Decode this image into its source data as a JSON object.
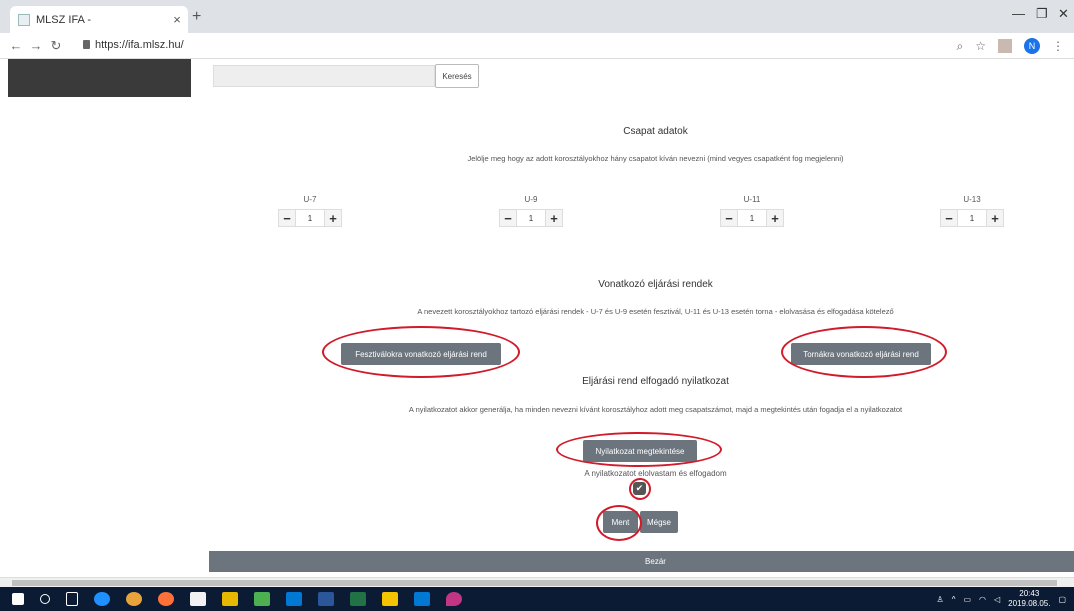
{
  "browser": {
    "tab_title": "MLSZ IFA -",
    "tab_close": "×",
    "new_tab": "+",
    "url": "https://ifa.mlsz.hu/",
    "window_min": "—",
    "window_max": "❐",
    "window_close": "✕"
  },
  "search": {
    "button_label": "Keresés"
  },
  "team": {
    "title": "Csapat adatok",
    "subtitle": "Jelölje meg hogy az adott korosztályokhoz hány csapatot kíván nevezni (mind vegyes csapatként fog megjelenni)",
    "ages": [
      {
        "label": "U-7",
        "value": "1"
      },
      {
        "label": "U-9",
        "value": "1"
      },
      {
        "label": "U-11",
        "value": "1"
      },
      {
        "label": "U-13",
        "value": "1"
      }
    ],
    "minus": "−",
    "plus": "+"
  },
  "rules": {
    "title": "Vonatkozó eljárási rendek",
    "subtitle": "A nevezett korosztályokhoz tartozó eljárási rendek - U-7 és U-9 esetén fesztivál, U-11 és U-13 esetén torna - elolvasása és elfogadása kötelező",
    "festival_button": "Fesztiválokra vonatkozó eljárási rend",
    "tournament_button": "Tornákra vonatkozó eljárási rend"
  },
  "declaration": {
    "title": "Eljárási rend elfogadó nyilatkozat",
    "subtitle": "A nyilatkozatot akkor generálja, ha minden nevezni kívánt korosztályhoz adott meg csapatszámot, majd a megtekintés után fogadja el a nyilatkozatot",
    "view_button": "Nyilatkozat megtekintése",
    "accept_label": "A nyilatkozatot elolvastam és elfogadom",
    "accepted": true,
    "check_glyph": "✔"
  },
  "actions": {
    "save": "Ment",
    "cancel": "Mégse",
    "close": "Bezár"
  },
  "taskbar": {
    "time": "20:43",
    "date": "2019.08.05."
  },
  "colors": {
    "button_gray": "#6c757d",
    "annotation_red": "#d11a2a",
    "taskbar": "#0b1b33"
  }
}
